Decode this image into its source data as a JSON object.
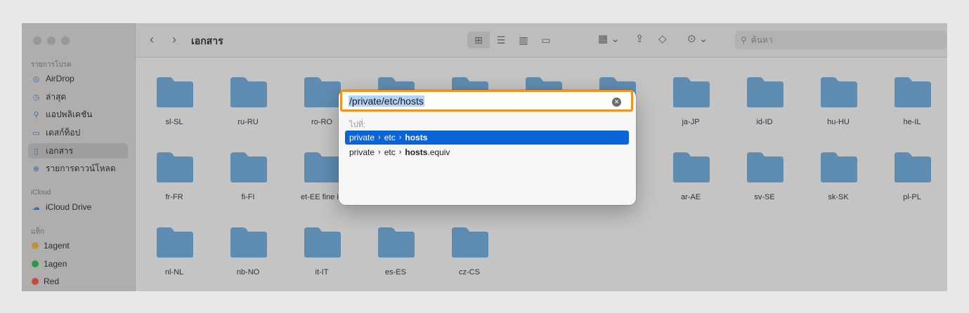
{
  "window": {
    "title": "เอกสาร",
    "search_placeholder": "ค้นหา"
  },
  "sidebar": {
    "favorites_header": "รายการโปรด",
    "favorites": [
      {
        "label": "AirDrop",
        "icon": "airdrop-icon"
      },
      {
        "label": "ล่าสุด",
        "icon": "clock-icon"
      },
      {
        "label": "แอปพลิเคชัน",
        "icon": "applications-icon"
      },
      {
        "label": "เดสก์ท็อป",
        "icon": "desktop-icon"
      },
      {
        "label": "เอกสาร",
        "icon": "document-icon",
        "selected": true
      },
      {
        "label": "รายการดาวน์โหลด",
        "icon": "downloads-icon"
      }
    ],
    "icloud_header": "iCloud",
    "icloud": [
      {
        "label": "iCloud Drive",
        "icon": "cloud-icon"
      }
    ],
    "tags_header": "แท็ก",
    "tags": [
      {
        "label": "1agent",
        "color": "#f5c343"
      },
      {
        "label": "1agen",
        "color": "#34c759"
      },
      {
        "label": "Red",
        "color": "#ff5f57"
      }
    ]
  },
  "folders": {
    "row1": [
      "sl-SL",
      "ru-RU",
      "ro-RO",
      "",
      "",
      "",
      "",
      "ja-JP",
      "id-ID",
      "hu-HU",
      "he-IL"
    ],
    "row2": [
      "fr-FR",
      "fi-FI",
      "et-EE fine in",
      "",
      "",
      "",
      "",
      "ar-AE",
      "sv-SE",
      "sk-SK",
      "pl-PL"
    ],
    "row3": [
      "nl-NL",
      "nb-NO",
      "it-IT",
      "es-ES",
      "cz-CS"
    ]
  },
  "goto": {
    "path_value": "/private/etc/hosts",
    "label": "ไปที่:",
    "suggestions": [
      {
        "parts": [
          "private",
          "etc"
        ],
        "match": "hosts",
        "suffix": "",
        "selected": true
      },
      {
        "parts": [
          "private",
          "etc"
        ],
        "match": "hosts",
        "suffix": ".equiv",
        "selected": false
      }
    ]
  },
  "colors": {
    "highlight_border": "#f0921e",
    "selection_blue": "#0a64d8",
    "folder_blue": "#7cb6e6"
  }
}
